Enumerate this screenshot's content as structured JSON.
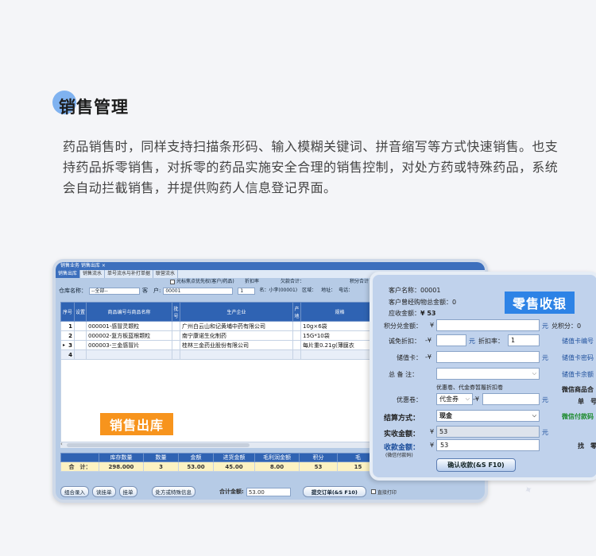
{
  "section": {
    "title": "销售管理",
    "description": "药品销售时，同样支持扫描条形码、输入模糊关键词、拼音缩写等方式快速销售。也支持药品拆零销售，对拆零的药品实施安全合理的销售控制，对处方药或特殊药品，系统会自动拦截销售，并提供购药人信息登记界面。"
  },
  "sales_window": {
    "top_tabs": "销售业务  销售出库 ×",
    "sub_tabs": [
      "销售出库",
      "销售流水",
      "单号流水与补打单据",
      "联营流水"
    ],
    "options_line": {
      "checkbox_label": "光标焦点优先权(客户/药品)",
      "discount_label": "折扣率",
      "arrears_label": "欠款合计：",
      "points_label": "积分合计"
    },
    "form": {
      "warehouse_label": "仓库名称：",
      "warehouse_value": "--全部--",
      "customer_label": "客　户:",
      "customer_value": "00001",
      "qty_value": "1",
      "name_label": "名：小李(00001)",
      "area_label": "区域：",
      "address_label": "地址：",
      "phone_label": "电话："
    },
    "grid": {
      "headers": [
        "序号",
        "设置",
        "商品编号与商品名称",
        "批号",
        "生产企业",
        "产地",
        "规格"
      ],
      "rows": [
        {
          "no": "1",
          "item": "000001-感冒灵颗粒",
          "maker": "广州白云山和记黄埔中药有限公司",
          "spec": "10g×6袋"
        },
        {
          "no": "2",
          "item": "000002-复方板蓝根颗粒",
          "maker": "南宁康诺生化制药",
          "spec": "15G*10袋"
        },
        {
          "no": "3",
          "item": "000003-三金感冒片",
          "maker": "桂林三金药业股份有限公司",
          "spec": "每片重0.21g(薄膜衣"
        },
        {
          "no": "4",
          "item": "",
          "maker": "",
          "spec": ""
        }
      ],
      "current_row_marker": "▸"
    },
    "stamp": "销售出库",
    "summary": {
      "headers": [
        "",
        "库存数量",
        "数量",
        "金额",
        "进货金额",
        "毛利润金额",
        "积分",
        "毛"
      ],
      "total_label": "合　计：",
      "values": [
        "298.000",
        "3",
        "53.00",
        "45.00",
        "8.00",
        "53",
        "15"
      ]
    },
    "bottom": {
      "buttons": [
        "组合录入",
        "读挂单",
        "挂单",
        "处方或特殊信息"
      ],
      "total_label": "合计金额:",
      "total_value": "53.00",
      "submit_label": "提交订单(&S F10)",
      "print_label": "直接打印"
    }
  },
  "pos_panel": {
    "stamp": "零售收银",
    "customer_name_label": "客户名称：",
    "customer_name_value": "00001",
    "total_purchase_label": "客户曾经购物总金额：",
    "total_purchase_value": "0",
    "receivable_label": "应收金额：",
    "receivable_value": "¥ 53",
    "points_label": "积分兑金额：",
    "points_prefix": "¥",
    "points_unit": "元",
    "points_right": "兑积分：0",
    "discount_label": "诚免折扣：",
    "discount_prefix": "-¥",
    "discount_unit": "元",
    "discount_rate_label": "折扣率：",
    "discount_rate_value": "1",
    "stored_card_label": "储值卡：",
    "stored_card_prefix": "-¥",
    "stored_card_unit": "元",
    "stored_card_no": "储值卡编号",
    "stored_card_pwd": "储值卡密码",
    "stored_card_bal": "储值卡余额",
    "note_label": "总 备 注：",
    "coupon_note": "优惠卷、代金券暂履折扣卷",
    "coupon_label": "优惠卷：",
    "coupon_value": "代金券",
    "coupon_prefix": "-¥",
    "coupon_unit": "元",
    "wechat_pay_title": "微信商品合",
    "wechat_pay_sub": "单　号",
    "wechat_paid": "微信付款码",
    "settle_label": "结算方式：",
    "settle_value": "现金",
    "actual_label": "实收金额：",
    "actual_prefix": "¥",
    "actual_value": "53",
    "actual_unit": "元",
    "collect_label": "收款金额：",
    "collect_sub": "(微信付款码)",
    "collect_prefix": "¥",
    "collect_value": "53",
    "change_label": "找　零",
    "confirm_button": "确认收款(&S F10)"
  }
}
